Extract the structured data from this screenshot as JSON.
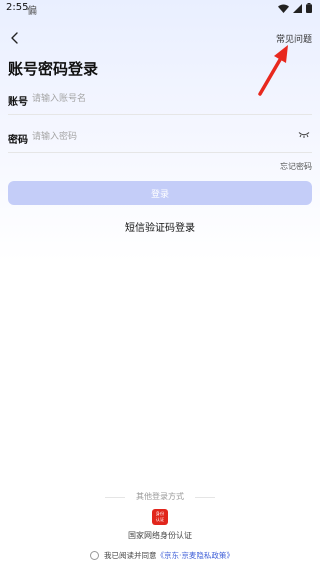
{
  "status_bar": {
    "time": "2:55",
    "app_badge": "偏"
  },
  "header": {
    "faq_label": "常见问题"
  },
  "title": "账号密码登录",
  "account": {
    "label": "账号",
    "placeholder": "请输入账号名"
  },
  "password": {
    "label": "密码",
    "placeholder": "请输入密码"
  },
  "forgot_label": "忘记密码",
  "login_label": "登录",
  "sms_login_label": "短信验证码登录",
  "other": {
    "divider_text": "其他登录方式",
    "gov_icon_text": "身份\n认证",
    "gov_label": "国家网络身份认证"
  },
  "agreement": {
    "prefix": "我已阅读并同意",
    "link": "《京东·京麦隐私政策》"
  },
  "colors": {
    "button_disabled": "#c4cdf8",
    "link": "#3f5fd8",
    "gov_red": "#e1261c",
    "annotation_arrow": "#e8281e"
  },
  "icons": {
    "back": "chevron-left-icon",
    "eye": "eye-closed-icon",
    "wifi": "wifi-icon",
    "signal": "signal-icon",
    "battery": "battery-icon"
  }
}
